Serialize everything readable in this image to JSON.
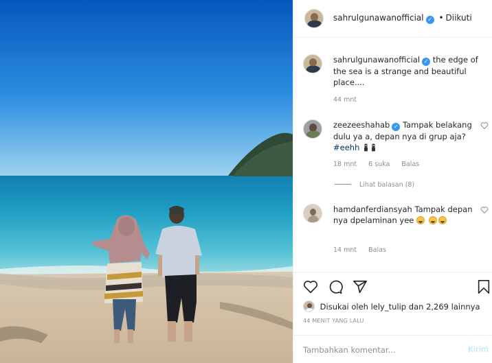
{
  "post": {
    "author": "sahrulgunawanofficial",
    "follow_state": "Diikuti",
    "separator": "•",
    "caption": "the edge of the sea is a strange and beautiful place....",
    "caption_time": "44 mnt"
  },
  "comments": [
    {
      "username": "zeezeeshahab",
      "verified": true,
      "text": "Tampak belakang dulu ya a, depan nya di grup aja?",
      "hashtag": "#eehh",
      "time": "18 mnt",
      "likes": "6 suka",
      "reply": "Balas",
      "view_replies": "Lihat balasan (8)"
    },
    {
      "username": "hamdanferdiansyah",
      "verified": false,
      "text": "Tampak depan nya dpelaminan yee",
      "time": "14 mnt",
      "reply": "Balas"
    }
  ],
  "likes_text": {
    "prefix": "Disukai oleh",
    "user": "lely_tulip",
    "middle": "dan",
    "count": "2,269",
    "suffix": "lainnya"
  },
  "time_ago": "44 MENIT YANG LALU",
  "add_comment": {
    "placeholder": "Tambahkan komentar...",
    "post_label": "Kirim"
  },
  "icons": {
    "like": "heart-icon",
    "comment": "comment-icon",
    "share": "share-icon",
    "save": "bookmark-icon",
    "verified": "verified-badge-icon"
  },
  "colors": {
    "verified": "#3897f0",
    "muted_text": "#8e8e8e",
    "hashtag": "#00376b",
    "post_button": "#b2dffc"
  }
}
